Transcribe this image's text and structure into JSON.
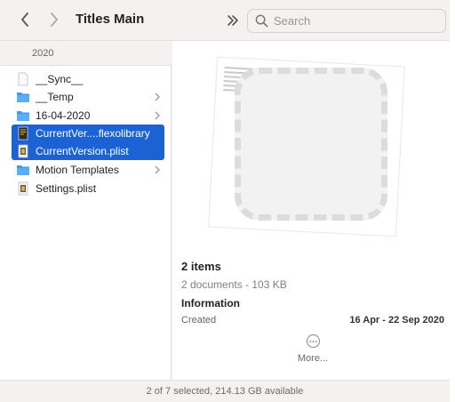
{
  "window": {
    "title": "Titles Main"
  },
  "search": {
    "placeholder": "Search"
  },
  "column": {
    "header": "2020",
    "items": [
      {
        "label": "__Sync__",
        "kind": "file-blank",
        "selected": false,
        "has_children": false
      },
      {
        "label": "__Temp",
        "kind": "folder",
        "selected": false,
        "has_children": true
      },
      {
        "label": "16-04-2020",
        "kind": "folder",
        "selected": false,
        "has_children": true
      },
      {
        "label": "CurrentVer....flexolibrary",
        "kind": "file-dark",
        "selected": true,
        "has_children": false
      },
      {
        "label": "CurrentVersion.plist",
        "kind": "file-plist",
        "selected": true,
        "has_children": false
      },
      {
        "label": "Motion Templates",
        "kind": "folder",
        "selected": false,
        "has_children": true
      },
      {
        "label": "Settings.plist",
        "kind": "file-plist",
        "selected": false,
        "has_children": false
      }
    ]
  },
  "preview": {
    "items_title": "2 items",
    "items_subtitle": "2 documents - 103 KB",
    "info_title": "Information",
    "created_label": "Created",
    "created_value": "16 Apr - 22 Sep 2020",
    "more_label": "More..."
  },
  "status": {
    "text": "2 of 7 selected, 214.13 GB available"
  },
  "colors": {
    "accent": "#1b62d4",
    "folder": "#3d9bf0"
  }
}
